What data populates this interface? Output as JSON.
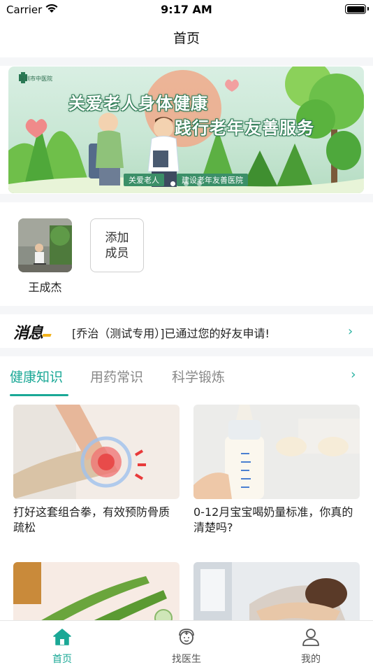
{
  "status_bar": {
    "carrier": "Carrier",
    "time": "9:17 AM"
  },
  "nav": {
    "title": "首页"
  },
  "banner": {
    "logo_text": "深圳市中医院",
    "headline_1": "关爱老人身体健康",
    "headline_2": "践行老年友善服务",
    "tag_1": "关爱老人",
    "tag_2": "建设老年友善医院",
    "slide_count": 3,
    "active_slide": 1
  },
  "members": {
    "items": [
      {
        "name": "王成杰"
      }
    ],
    "add_label_line1": "添加",
    "add_label_line2": "成员"
  },
  "message": {
    "logo": "消息",
    "text": "[乔治（测试专用）]已通过您的好友申请!",
    "arrow": "›"
  },
  "knowledge_tabs": {
    "items": [
      {
        "label": "健康知识",
        "active": true
      },
      {
        "label": "用药常识",
        "active": false
      },
      {
        "label": "科学锻炼",
        "active": false
      }
    ],
    "more_arrow": "›"
  },
  "articles": [
    {
      "title": "打好这套组合拳，有效预防骨质疏松",
      "image": "knee-pain-image"
    },
    {
      "title": "0-12月宝宝喝奶量标准，你真的清楚吗?",
      "image": "baby-bottle-image"
    },
    {
      "title": "",
      "image": "cucumber-image"
    },
    {
      "title": "",
      "image": "tired-woman-image"
    }
  ],
  "tabbar": {
    "items": [
      {
        "label": "首页",
        "icon": "home-icon",
        "active": true
      },
      {
        "label": "找医生",
        "icon": "doctor-icon",
        "active": false
      },
      {
        "label": "我的",
        "icon": "user-icon",
        "active": false
      }
    ]
  },
  "colors": {
    "accent": "#1aa896",
    "banner_green": "#3b8f68",
    "gap": "#f5f6f8"
  }
}
